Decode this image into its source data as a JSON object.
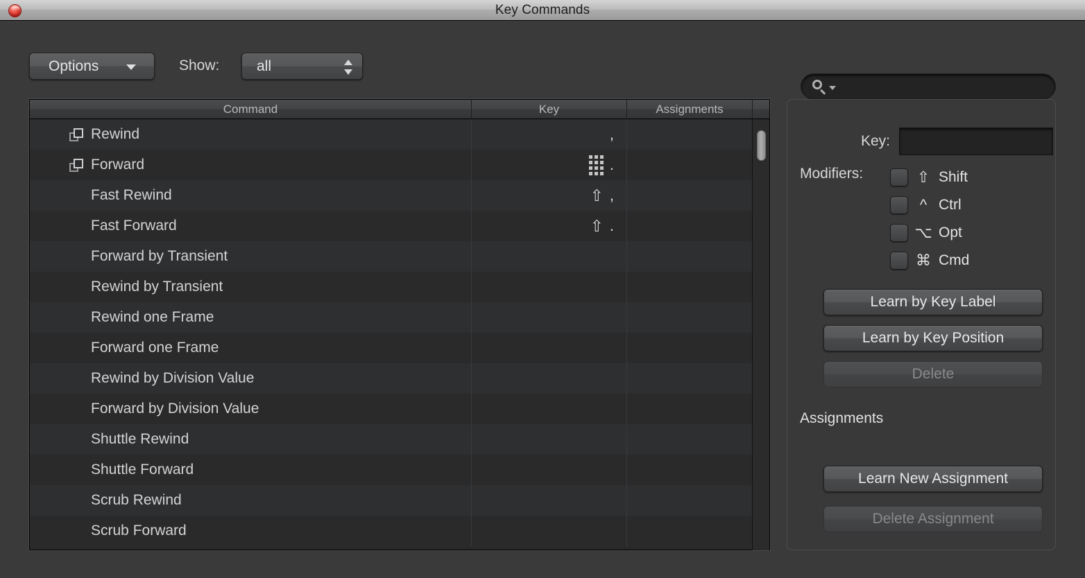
{
  "window": {
    "title": "Key Commands",
    "close_icon": "close-button-red"
  },
  "toolbar": {
    "options_label": "Options",
    "options_caret_icon": "triangle-down-icon",
    "show_label": "Show:",
    "show_value": "all",
    "show_stepper_icon": "stepper-up-down-icon",
    "search_icon": "search-magnifier-icon",
    "search_caret_icon": "triangle-down-icon",
    "search_value": "",
    "search_placeholder": ""
  },
  "table": {
    "columns": [
      "Command",
      "Key",
      "Assignments"
    ],
    "duplicate_icon": "cascade-windows-icon",
    "numpad_icon": "numeric-keypad-icon",
    "shift_glyph": "⇧",
    "rows": [
      {
        "command": "Rewind",
        "icon": "cascade-windows-icon",
        "key_mod": "",
        "key_pad": false,
        "key": ",",
        "assignments": ""
      },
      {
        "command": "Forward",
        "icon": "cascade-windows-icon",
        "key_mod": "",
        "key_pad": true,
        "key": ".",
        "assignments": ""
      },
      {
        "command": "Fast Rewind",
        "icon": "",
        "key_mod": "⇧",
        "key_pad": false,
        "key": ",",
        "assignments": ""
      },
      {
        "command": "Fast Forward",
        "icon": "",
        "key_mod": "⇧",
        "key_pad": false,
        "key": ".",
        "assignments": ""
      },
      {
        "command": "Forward by Transient",
        "icon": "",
        "key_mod": "",
        "key_pad": false,
        "key": "",
        "assignments": ""
      },
      {
        "command": "Rewind by Transient",
        "icon": "",
        "key_mod": "",
        "key_pad": false,
        "key": "",
        "assignments": ""
      },
      {
        "command": "Rewind one Frame",
        "icon": "",
        "key_mod": "",
        "key_pad": false,
        "key": "",
        "assignments": ""
      },
      {
        "command": "Forward one Frame",
        "icon": "",
        "key_mod": "",
        "key_pad": false,
        "key": "",
        "assignments": ""
      },
      {
        "command": "Rewind by Division Value",
        "icon": "",
        "key_mod": "",
        "key_pad": false,
        "key": "",
        "assignments": ""
      },
      {
        "command": "Forward by Division Value",
        "icon": "",
        "key_mod": "",
        "key_pad": false,
        "key": "",
        "assignments": ""
      },
      {
        "command": "Shuttle Rewind",
        "icon": "",
        "key_mod": "",
        "key_pad": false,
        "key": "",
        "assignments": ""
      },
      {
        "command": "Shuttle Forward",
        "icon": "",
        "key_mod": "",
        "key_pad": false,
        "key": "",
        "assignments": ""
      },
      {
        "command": "Scrub Rewind",
        "icon": "",
        "key_mod": "",
        "key_pad": false,
        "key": "",
        "assignments": ""
      },
      {
        "command": "Scrub Forward",
        "icon": "",
        "key_mod": "",
        "key_pad": false,
        "key": "",
        "assignments": ""
      }
    ],
    "scrollbar": {
      "thumb_position_pct": 3
    }
  },
  "inspector": {
    "key_label": "Key:",
    "key_value": "",
    "modifiers_label": "Modifiers:",
    "modifiers": [
      {
        "symbol": "⇧",
        "name": "Shift",
        "checked": false,
        "icon": "shift-arrow-icon"
      },
      {
        "symbol": "^",
        "name": "Ctrl",
        "checked": false,
        "icon": "control-caret-icon"
      },
      {
        "symbol": "⌥",
        "name": "Opt",
        "checked": false,
        "icon": "option-key-icon"
      },
      {
        "symbol": "⌘",
        "name": "Cmd",
        "checked": false,
        "icon": "command-key-icon"
      }
    ],
    "learn_by_key_label": "Learn by Key Label",
    "learn_by_key_position": "Learn by Key Position",
    "delete": "Delete",
    "delete_enabled": false,
    "assignments_heading": "Assignments",
    "learn_new_assignment": "Learn New Assignment",
    "delete_assignment": "Delete Assignment",
    "delete_assignment_enabled": false
  },
  "colors": {
    "window_bg": "#3a3a3a",
    "titlebar_top": "#d4d4d4",
    "row_odd": "#2e2f31",
    "row_even": "#2a2a2b",
    "text": "#d4d4d4",
    "close_red": "#ef5348"
  }
}
